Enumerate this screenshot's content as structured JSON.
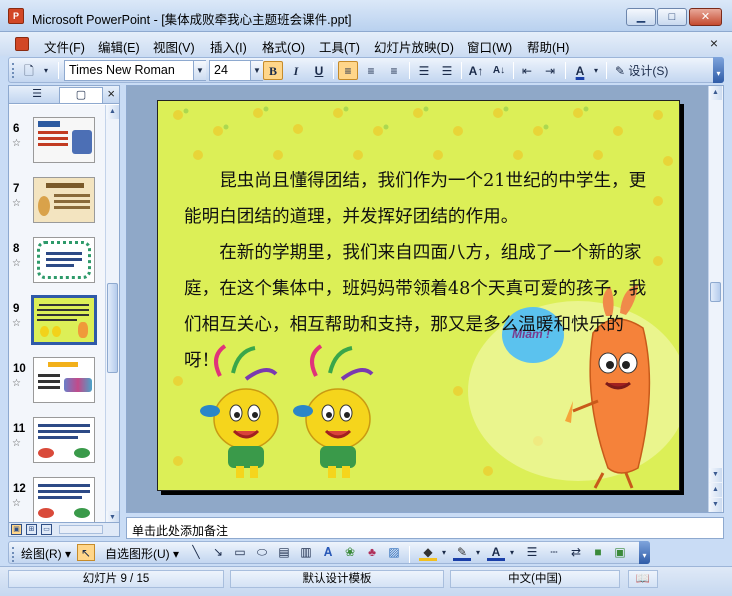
{
  "window": {
    "title": "Microsoft PowerPoint - [集体成败牵我心主题班会课件.ppt]",
    "app_icon_text": "P",
    "min_icon": "minimize-icon",
    "max_icon": "maximize-icon",
    "close_icon": "close-icon"
  },
  "menu": {
    "items": [
      "文件(F)",
      "编辑(E)",
      "视图(V)",
      "插入(I)",
      "格式(O)",
      "工具(T)",
      "幻灯片放映(D)",
      "窗口(W)",
      "帮助(H)"
    ],
    "close_glyph": "×"
  },
  "toolbar": {
    "font": "Times New Roman",
    "size": "24",
    "bold": "B",
    "italic": "I",
    "underline": "U",
    "design_label": "设计(S)",
    "align_left_active": true
  },
  "slides_panel": {
    "tab_outline": "outline-tab-icon",
    "tab_slides": "slides-tab-icon",
    "close_glyph": "×",
    "thumbnails": [
      {
        "number": "6"
      },
      {
        "number": "7"
      },
      {
        "number": "8"
      },
      {
        "number": "9",
        "selected": true
      },
      {
        "number": "10"
      },
      {
        "number": "11"
      },
      {
        "number": "12"
      }
    ]
  },
  "slide": {
    "paragraph1": "昆虫尚且懂得团结，我们作为一个21世纪的中学生，更能明白团结的道理，并发挥好团结的作用。",
    "paragraph2": "在新的学期里，我们来自四面八方，组成了一个新的家庭，在这个集体中，班妈妈带领着48个天真可爱的孩子，我们相互关心，相互帮助和支持，那又是多么温暖和快乐的呀！",
    "speech_text": "Miam !",
    "background_color": "#dcef57"
  },
  "notes": {
    "placeholder": "单击此处添加备注"
  },
  "drawing_toolbar": {
    "draw_label": "绘图(R)",
    "autoshapes_label": "自选图形(U)"
  },
  "status": {
    "slide_info": "幻灯片 9 / 15",
    "template": "默认设计模板",
    "language": "中文(中国)"
  }
}
